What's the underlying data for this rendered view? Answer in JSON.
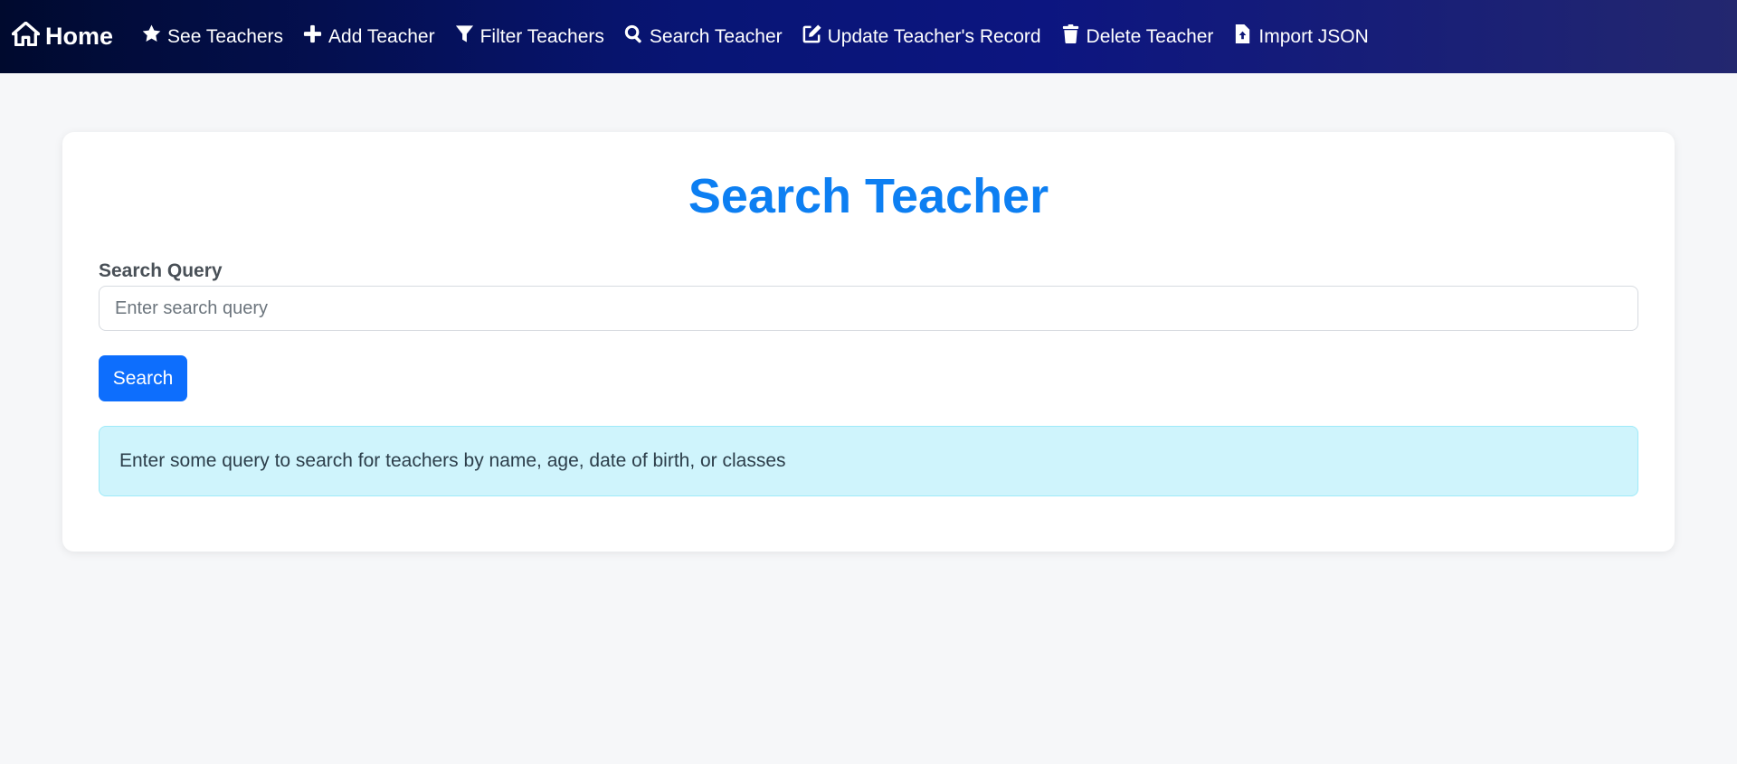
{
  "navbar": {
    "brand": {
      "label": "Home",
      "icon": "home-icon"
    },
    "items": [
      {
        "label": "See Teachers",
        "icon": "star-icon"
      },
      {
        "label": "Add Teacher",
        "icon": "plus-icon"
      },
      {
        "label": "Filter Teachers",
        "icon": "filter-icon"
      },
      {
        "label": "Search Teacher",
        "icon": "search-icon"
      },
      {
        "label": "Update Teacher's Record",
        "icon": "edit-icon"
      },
      {
        "label": "Delete Teacher",
        "icon": "trash-icon"
      },
      {
        "label": "Import JSON",
        "icon": "file-upload-icon"
      }
    ]
  },
  "main": {
    "title": "Search Teacher",
    "search": {
      "label": "Search Query",
      "placeholder": "Enter search query",
      "value": "",
      "button_label": "Search"
    },
    "info_message": "Enter some query to search for teachers by name, age, date of birth, or classes"
  },
  "colors": {
    "title": "#0d7ff2",
    "primary_button": "#0d6efd",
    "alert_background": "#cff4fc",
    "navbar_start": "#000a2e",
    "navbar_end": "#23276f"
  }
}
